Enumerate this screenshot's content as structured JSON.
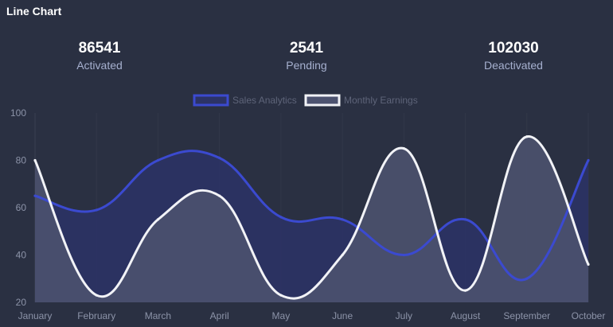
{
  "card": {
    "title": "Line Chart"
  },
  "stats": [
    {
      "value": "86541",
      "label": "Activated"
    },
    {
      "value": "2541",
      "label": "Pending"
    },
    {
      "value": "102030",
      "label": "Deactivated"
    }
  ],
  "colors": {
    "background": "#2a3042",
    "sales_line": "#3b4ad0",
    "sales_fill": "#2c3366",
    "earnings_line": "#f2f3f7",
    "earnings_fill": "#4d5370",
    "axis_text": "#8c93a8",
    "legend_text": "#5e6479"
  },
  "chart_data": {
    "type": "area",
    "categories": [
      "January",
      "February",
      "March",
      "April",
      "May",
      "June",
      "July",
      "August",
      "September",
      "October"
    ],
    "series": [
      {
        "name": "Sales Analytics",
        "values": [
          65,
          59,
          80,
          81,
          56,
          55,
          40,
          55,
          30,
          80
        ]
      },
      {
        "name": "Monthly Earnings",
        "values": [
          80,
          23,
          55,
          65,
          23,
          40,
          85,
          25,
          90,
          36
        ]
      }
    ],
    "ylim": [
      20,
      100
    ],
    "yticks": [
      20,
      40,
      60,
      80,
      100
    ],
    "legend_position": "top-center",
    "grid": true
  }
}
